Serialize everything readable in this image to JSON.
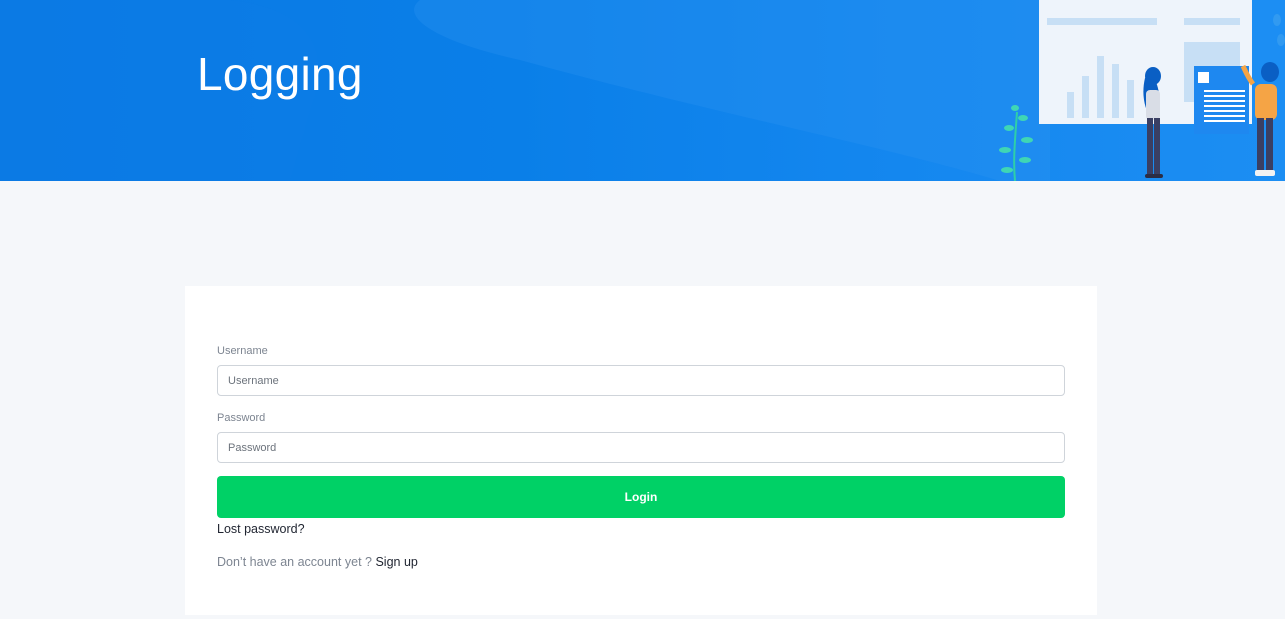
{
  "header": {
    "title": "Logging"
  },
  "form": {
    "username": {
      "label": "Username",
      "placeholder": "Username",
      "value": ""
    },
    "password": {
      "label": "Password",
      "placeholder": "Password",
      "value": ""
    },
    "login_label": "Login",
    "lost_password_label": "Lost password?",
    "no_account_text": "Don’t have an account yet ?",
    "signup_label": "Sign up"
  },
  "colors": {
    "hero_blue": "#0b78e3",
    "login_green": "#00d166",
    "page_background": "#f5f7fa"
  }
}
